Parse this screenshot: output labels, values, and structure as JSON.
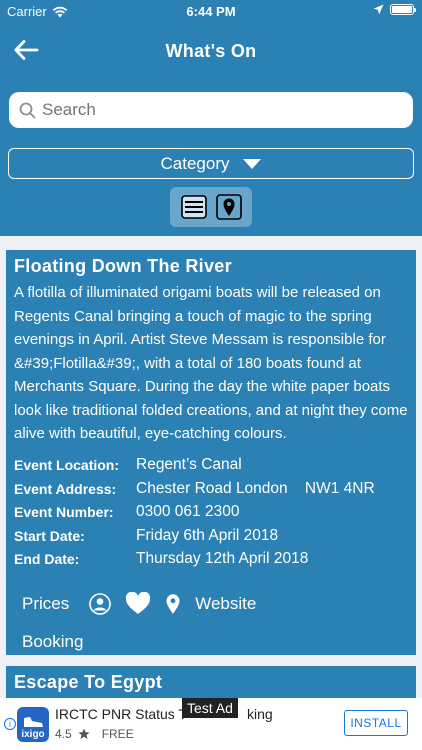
{
  "status_bar": {
    "carrier": "Carrier",
    "time": "6:44 PM"
  },
  "header": {
    "title": "What's On"
  },
  "search": {
    "placeholder": "Search"
  },
  "filter": {
    "category_label": "Category"
  },
  "events": [
    {
      "title": "Floating Down The River",
      "description": "A flotilla of illuminated origami boats will be released on Regents Canal bringing a touch of magic to the spring evenings in April. Artist Steve Messam is responsible for &#39;Flotilla&#39;, with a total of 180 boats found at Merchants Square. During the day the white paper boats look like traditional folded creations, and at night they come alive with beautiful, eye-catching colours.",
      "details": [
        {
          "label": "Event Location:",
          "value": "Regent’s Canal"
        },
        {
          "label": "Event Address:",
          "value": "Chester Road London    NW1 4NR"
        },
        {
          "label": "Event Number:",
          "value": "0300 061 2300"
        },
        {
          "label": "Start Date:",
          "value": "Friday 6th April 2018"
        },
        {
          "label": "End Date:",
          "value": "Thursday 12th April 2018"
        }
      ],
      "actions": {
        "prices": "Prices",
        "website": "Website",
        "booking": "Booking"
      }
    },
    {
      "title": "Escape To Egypt"
    }
  ],
  "ad": {
    "badge": "Test Ad",
    "app_name": "IRCTC PNR Status T",
    "app_name_tail": "king",
    "logo_text": "ixigo",
    "rating": "4.5",
    "price": "FREE",
    "install_label": "INSTALL",
    "info_glyph": "i"
  },
  "colors": {
    "primary": "#2b80b4",
    "toggle_bg": "#6aa5cc",
    "list_bg": "#eef2f6",
    "install": "#1a73e8"
  }
}
